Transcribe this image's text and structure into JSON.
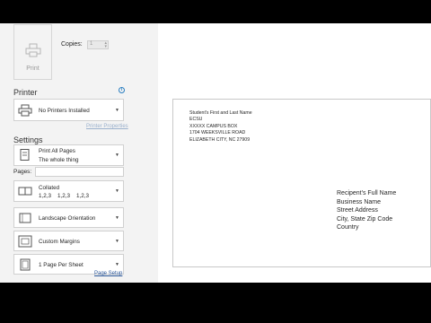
{
  "print_button": {
    "label": "Print"
  },
  "copies": {
    "label": "Copies:",
    "value": "1"
  },
  "printer": {
    "heading": "Printer",
    "selected": "No Printers Installed",
    "properties_link": "Printer Properties"
  },
  "settings": {
    "heading": "Settings",
    "print_what": {
      "line1": "Print All Pages",
      "line2": "The whole thing"
    },
    "pages_label": "Pages:",
    "pages_value": "",
    "collation": {
      "line1": "Collated",
      "line2": "1,2,3    1,2,3    1,2,3"
    },
    "orientation": "Landscape Orientation",
    "margins": "Custom Margins",
    "pages_per_sheet": "1 Page Per Sheet",
    "page_setup_link": "Page Setup"
  },
  "envelope": {
    "return_address": [
      "Student's First and Last Name",
      "ECSU",
      "XXXXX CAMPUS BOX",
      "1704 WEEKSVILLE ROAD",
      "ELIZABETH CITY, NC 27909"
    ],
    "recipient": [
      "Recipent's Full Name",
      "Business Name",
      "Street Address",
      "City, State Zip Code",
      "Country"
    ]
  },
  "colors": {
    "panel_bg": "#f3f3f3",
    "link": "#2b579a",
    "info_icon": "#2b7fc1"
  },
  "icons": [
    "printer-icon",
    "info-icon",
    "pages-icon",
    "collated-icon",
    "landscape-icon",
    "margins-icon",
    "pages-per-sheet-icon",
    "dropdown-arrow-icon"
  ]
}
